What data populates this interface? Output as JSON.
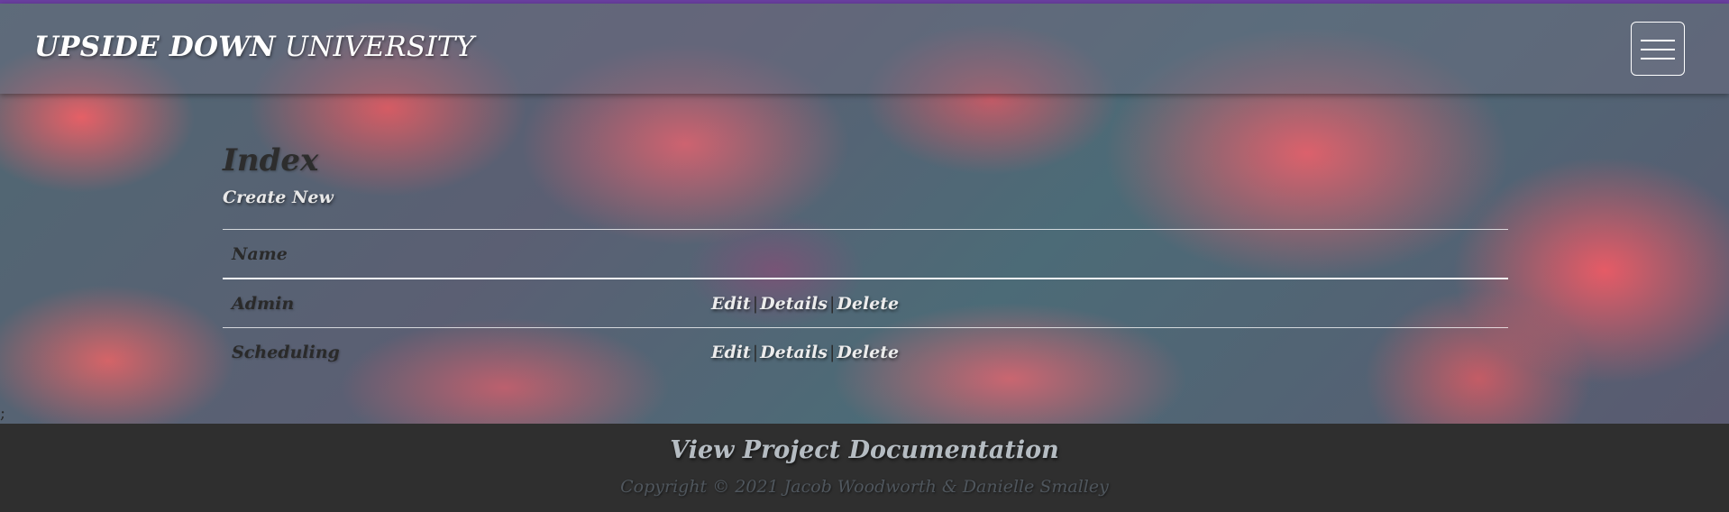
{
  "header": {
    "brand_bold": "UPSIDE DOWN",
    "brand_regular": "UNIVERSITY",
    "menu_icon": "hamburger-menu-icon"
  },
  "main": {
    "title": "Index",
    "create_link": "Create New",
    "table": {
      "columns": [
        "Name"
      ],
      "rows": [
        {
          "name": "Admin",
          "edit": "Edit",
          "details": "Details",
          "delete": "Delete"
        },
        {
          "name": "Scheduling",
          "edit": "Edit",
          "details": "Details",
          "delete": "Delete"
        }
      ],
      "separator": "|"
    },
    "stray_text": ";"
  },
  "footer": {
    "doc_link": "View Project Documentation",
    "copyright": "Copyright © 2021 Jacob Woodworth & Danielle Smalley"
  },
  "colors": {
    "top_line": "#6a3fa0",
    "footer_bg": "#2f2f2f"
  }
}
